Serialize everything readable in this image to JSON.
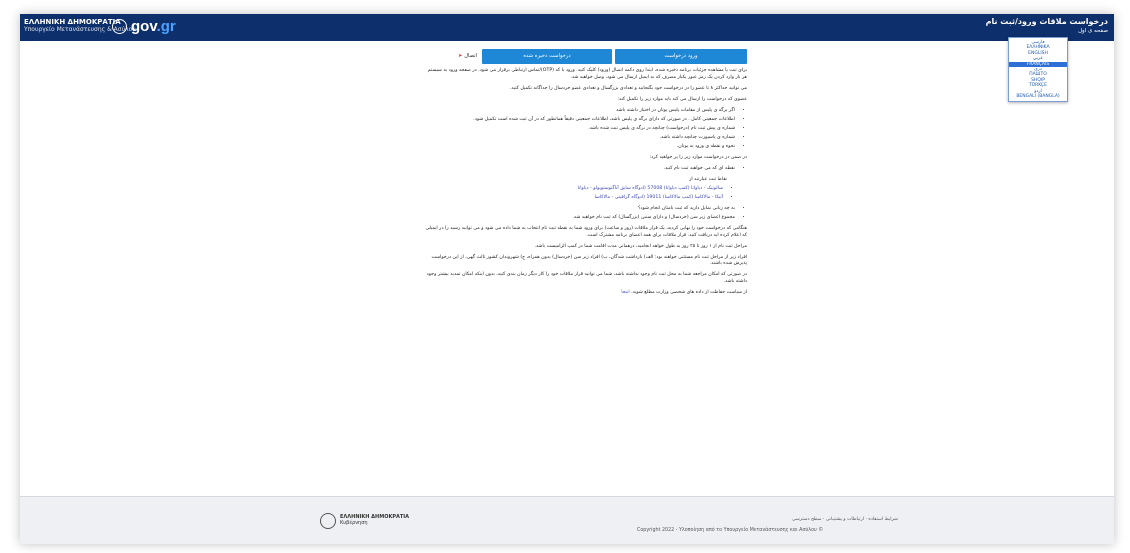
{
  "header": {
    "brand_line1": "ΕΛΛΗΝΙΚΗ ΔΗΜΟΚΡΑΤΙΑ",
    "brand_line2": "Υπουργείο Μετανάστευσης & Ασύλου",
    "gov_logo_main": "gov",
    "gov_logo_suffix": ".gr",
    "app_title": "درخواست ملاقات ورود/ثبت نام",
    "home_link": "صفحه ی اول"
  },
  "language_menu": {
    "options": [
      "فارسی",
      "ΕΛΛΗΝΙΚΑ",
      "ENGLISH",
      "عربي",
      "FRANÇAIS",
      "دری",
      "ПАШТО",
      "SHQIP",
      "TÜRKÇE",
      "اردو",
      "BENGALI (BANGLA)"
    ],
    "selected_index": 4
  },
  "toolbar": {
    "login_button": "ورود درخواست",
    "saved_request_button": "درخواست ذخیره شده",
    "connect_label": "اتصال",
    "connect_icon": "sign-in-icon"
  },
  "content": {
    "p1": "برای ثبت یا مشاهده جزئیات برنامه ذخیره شده، ابتدا روی دکمه اتصال (ورود) کلیک کنید. ورود با کد (OTP)/تماس ارتباطی برقرار می شود. در صفحه ورود به سیستم هر بار وارد کردن یک رمز عبور یکبار مصرف که به ایمیل ارسال می شود، وصل خواهید شد.",
    "p2": "می توانید حداکثر ۸ تا عضو را در درخواست خود بگنجانید و تعدادی بزرگسال و تعدادی عضو خردسال را جداگانه تکمیل کنید.",
    "p3": "عضوی که درخواست را ارسال می کند باید موارد زیر را تکمیل کند:",
    "list1": [
      "اگر برگه ی پلیس از مقامات پلیس یونان در اختیار داشته باشد",
      "اطلاعات جمعیتی کامل . در صورتی که دارای برگه ی پلیس باشد، اطلاعات جمعیتی دقیقاً همانطور که در آن ثبت شده است تکمیل شود.",
      "شماره ی پیش ثبت نام (درخواست) چنانچه در برگه ی پلیس ثبت شده باشد.",
      "شماره ی پاسپورت چنانچه داشته باشد.",
      "نحوه و نقطه ی ورود به یونان."
    ],
    "p4": "در ضمن در درخواست موارد زیر را پر خواهید کرد:",
    "list2_item1": "نقطه ای که می خواهید ثبت نام کنید.",
    "list2_note": "نقاط ثبت عبارتند از",
    "sublist": [
      "سالونیک - دیاواتا (کمپ دیاواتا) 57008 (ادوگاه سابق آناگنوستوپولو - دیاواتا",
      "آتیکا - مالاکاسا (کمپ مالاکاسا) 19011 (ادوگاه گرافیتی - مالاکاسا"
    ],
    "list2_item2": "به چه زبانی تمایل دارید که ثبت نامتان انجام شود؟",
    "list2_item3": "مجموع اعضای زیر سن (خردسال) و دارای سنین (بزرگسال) که ثبت نام خواهید شد.",
    "p5": "هنگامی که درخواست خود را نهایی کردید، یک قرار ملاقات (روز و ساعت) برای ورود شما به نقطه ثبت نام انتخاب به شما داده می شود و می توانید رسید را در ایمیلی که اعلام کرده اید دریافت کنید. قرار ملاقات برای همه اعضای برنامه مشترک است.",
    "p6": "مراحل ثبت نام از ۱ روز تا ۲۵ روز به طول خواهد انجامید، درهمانی مدت اقامت شما در کمپ الزامیست باشد.",
    "p7": "افراد زیر از مراحل ثبت نام مستثنی خواهند بود: الف) بازداشت شدگان، ب) افراد زیر سن (خردسال) بدون همراه، ج) شهروندان کشور ثالث گهی، از این درخواست پذیرش شده باشند.",
    "p8": "در صورتی که امکان مراجعه شما به محل ثبت نام وجود نداشته باشد، شما می توانید قرار ملاقات خود را کار دیگر زمان بندی کنید، بدون اینکه امکان تمدید بیشتر وجود داشته باشد.",
    "p9_text": "از سیاست حفاظت از داده های شخصی وزارت مطلع شوید.",
    "p9_link": "اینجا"
  },
  "footer": {
    "org_line1": "ΕΛΛΗΝΙΚΗ ΔΗΜΟΚΡΑΤΙΑ",
    "org_line2": "Κυβέρνηση",
    "links": "شرایط استفاده · ارتباطات و پشتیبانی · سطح دسترسی",
    "copyright": "Copyright 2022 - Υλοποίηση από το Υπουργείο Μετανάστευσης και Ασύλου ©"
  }
}
